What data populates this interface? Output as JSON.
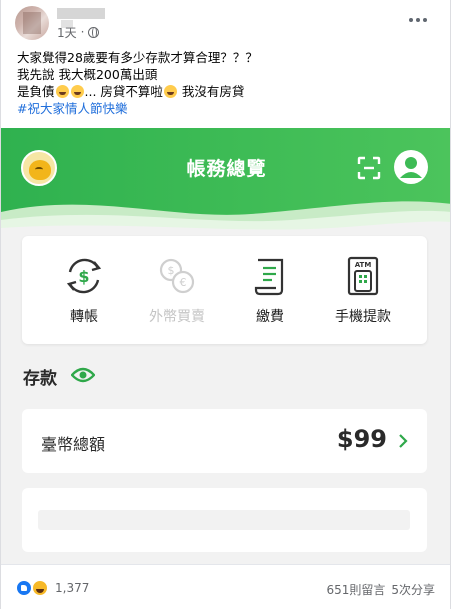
{
  "post": {
    "time": "1天",
    "separator": "·",
    "lines": [
      "大家覺得28歲要有多少存款才算合理？？？",
      "我先說 我大概200萬出頭"
    ],
    "line3_a": "是負債",
    "line3_b": "... 房貸不算啦",
    "line3_c": " 我沒有房貸",
    "hashtag": "#祝大家情人節快樂"
  },
  "app": {
    "title": "帳務總覽",
    "actions": [
      {
        "label": "轉帳",
        "enabled": true,
        "icon": "transfer-dollar-icon"
      },
      {
        "label": "外幣買賣",
        "enabled": false,
        "icon": "currency-exchange-icon"
      },
      {
        "label": "繳費",
        "enabled": true,
        "icon": "bill-icon"
      },
      {
        "label": "手機提款",
        "enabled": true,
        "icon": "atm-phone-icon"
      }
    ],
    "atm_text": "ATM",
    "section_title": "存款",
    "balance_label": "臺幣總額",
    "balance_value": "$99",
    "colors": {
      "brand_green": "#3dbb55",
      "icon_green": "#2fa84a"
    }
  },
  "footer": {
    "reaction_count": "1,377",
    "comments": "651則留言",
    "shares": "5次分享"
  }
}
